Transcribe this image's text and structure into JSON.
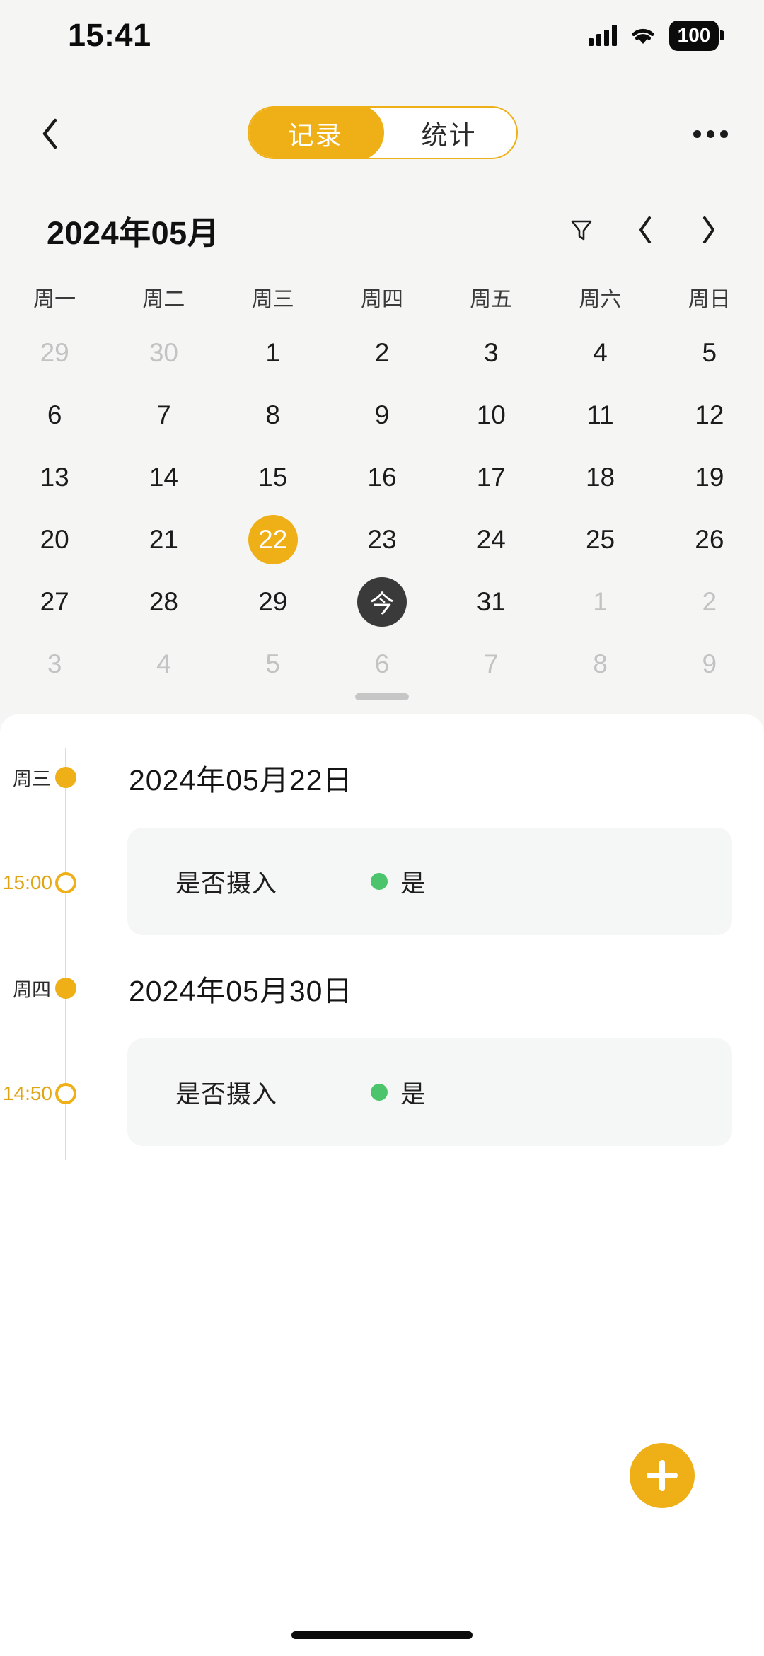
{
  "status_bar": {
    "time": "15:41",
    "battery_level": "100",
    "signal_icon": "cellular-signal-icon",
    "wifi_icon": "wifi-icon",
    "battery_icon": "battery-icon"
  },
  "nav": {
    "back_icon": "chevron-left-icon",
    "more_icon": "more-options-icon",
    "segments": [
      {
        "label": "记录",
        "active": true
      },
      {
        "label": "统计",
        "active": false
      }
    ]
  },
  "month_header": {
    "title": "2024年05月",
    "filter_icon": "filter-funnel-icon",
    "prev_icon": "chevron-left-icon",
    "next_icon": "chevron-right-icon",
    "prev_label": "‹",
    "next_label": "›"
  },
  "calendar": {
    "weekdays": [
      "周一",
      "周二",
      "周三",
      "周四",
      "周五",
      "周六",
      "周日"
    ],
    "selected_day": "22",
    "today_label": "今",
    "weeks": [
      [
        {
          "label": "29",
          "state": "dim"
        },
        {
          "label": "30",
          "state": "dim"
        },
        {
          "label": "1",
          "state": "normal"
        },
        {
          "label": "2",
          "state": "normal"
        },
        {
          "label": "3",
          "state": "normal"
        },
        {
          "label": "4",
          "state": "normal"
        },
        {
          "label": "5",
          "state": "normal"
        }
      ],
      [
        {
          "label": "6",
          "state": "normal"
        },
        {
          "label": "7",
          "state": "normal"
        },
        {
          "label": "8",
          "state": "normal"
        },
        {
          "label": "9",
          "state": "normal"
        },
        {
          "label": "10",
          "state": "normal"
        },
        {
          "label": "11",
          "state": "normal"
        },
        {
          "label": "12",
          "state": "normal"
        }
      ],
      [
        {
          "label": "13",
          "state": "normal"
        },
        {
          "label": "14",
          "state": "normal"
        },
        {
          "label": "15",
          "state": "normal"
        },
        {
          "label": "16",
          "state": "normal"
        },
        {
          "label": "17",
          "state": "normal"
        },
        {
          "label": "18",
          "state": "normal"
        },
        {
          "label": "19",
          "state": "normal"
        }
      ],
      [
        {
          "label": "20",
          "state": "normal"
        },
        {
          "label": "21",
          "state": "normal"
        },
        {
          "label": "22",
          "state": "selected"
        },
        {
          "label": "23",
          "state": "normal"
        },
        {
          "label": "24",
          "state": "normal"
        },
        {
          "label": "25",
          "state": "normal"
        },
        {
          "label": "26",
          "state": "normal"
        }
      ],
      [
        {
          "label": "27",
          "state": "normal"
        },
        {
          "label": "28",
          "state": "normal"
        },
        {
          "label": "29",
          "state": "normal"
        },
        {
          "label": "今",
          "state": "today"
        },
        {
          "label": "31",
          "state": "normal"
        },
        {
          "label": "1",
          "state": "dim"
        },
        {
          "label": "2",
          "state": "dim"
        }
      ],
      [
        {
          "label": "3",
          "state": "dim"
        },
        {
          "label": "4",
          "state": "dim"
        },
        {
          "label": "5",
          "state": "dim"
        },
        {
          "label": "6",
          "state": "dim"
        },
        {
          "label": "7",
          "state": "dim"
        },
        {
          "label": "8",
          "state": "dim"
        },
        {
          "label": "9",
          "state": "dim"
        }
      ]
    ]
  },
  "timeline": {
    "groups": [
      {
        "weekday": "周三",
        "date": "2024年05月22日",
        "entries": [
          {
            "time": "15:00",
            "label": "是否摄入",
            "value": "是",
            "dot_color": "#4CC46B"
          }
        ]
      },
      {
        "weekday": "周四",
        "date": "2024年05月30日",
        "entries": [
          {
            "time": "14:50",
            "label": "是否摄入",
            "value": "是",
            "dot_color": "#4CC46B"
          }
        ]
      }
    ]
  },
  "fab": {
    "icon": "plus-icon",
    "label": "+"
  },
  "colors": {
    "accent": "#EFB017",
    "today_bg": "#3A3A3A",
    "green_status": "#4CC46B",
    "card_bg": "#F5F6F6",
    "page_bg": "#F5F5F4",
    "sheet_bg": "#FFFFFF",
    "dim_text": "#C3C3C3"
  }
}
